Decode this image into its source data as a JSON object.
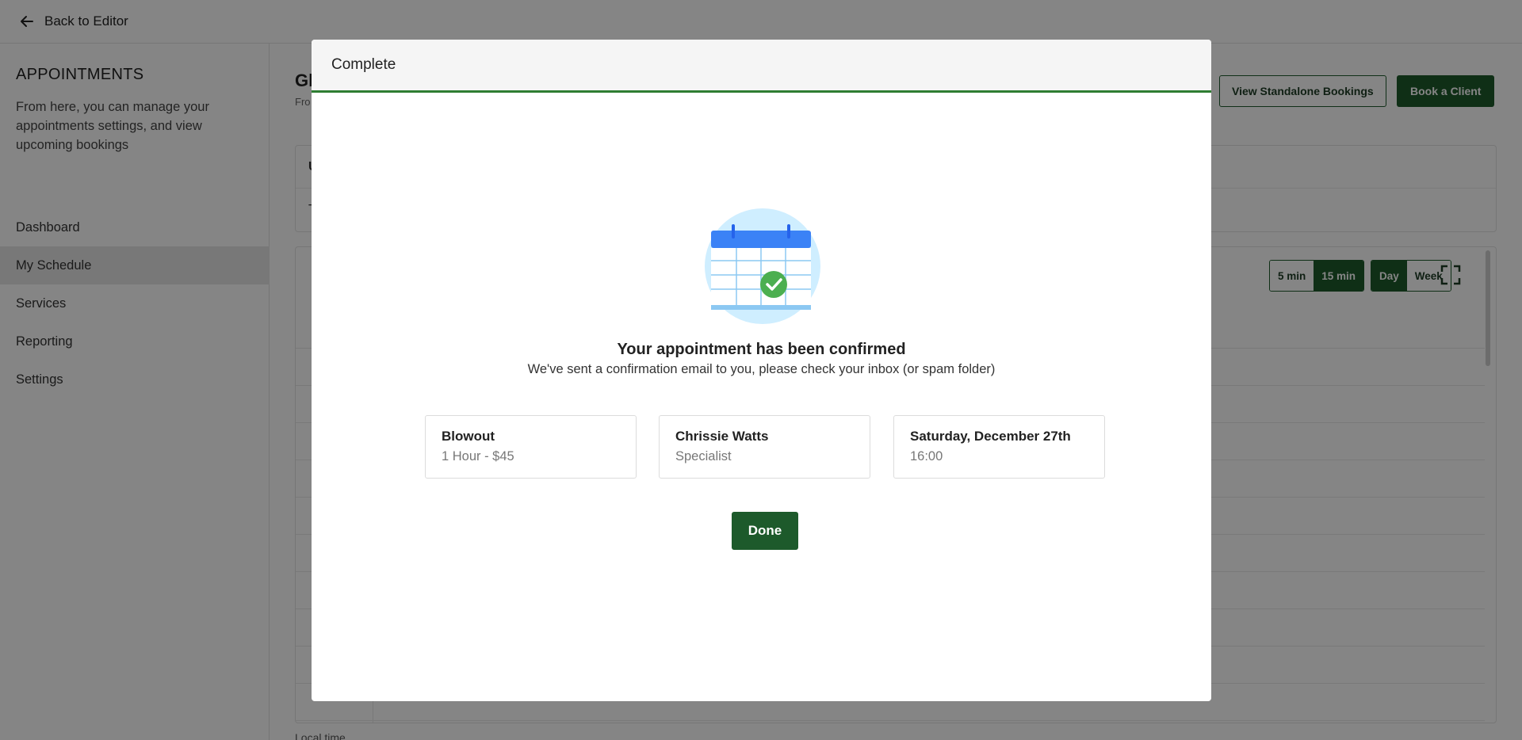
{
  "topbar": {
    "back_label": "Back to Editor"
  },
  "sidebar": {
    "title": "APPOINTMENTS",
    "description": "From here, you can manage your appointments settings, and view upcoming bookings",
    "items": [
      {
        "label": "Dashboard"
      },
      {
        "label": "My Schedule",
        "active": true
      },
      {
        "label": "Services"
      },
      {
        "label": "Reporting"
      },
      {
        "label": "Settings"
      }
    ]
  },
  "main": {
    "title": "Gl",
    "subtitle": "Fro",
    "view_standalone_label": "View Standalone Bookings",
    "book_client_label": "Book a Client",
    "card_row1": "U",
    "card_row2": "T",
    "interval_options": [
      "5 min",
      "15 min"
    ],
    "interval_selected": "15 min",
    "range_options": [
      "Day",
      "Week"
    ],
    "range_selected": "Day",
    "footer_text": "Local time"
  },
  "modal": {
    "header": "Complete",
    "title": "Your appointment has been confirmed",
    "subtitle": "We've sent a confirmation email to you, please check your inbox (or spam folder)",
    "service": {
      "name": "Blowout",
      "detail": "1 Hour - $45"
    },
    "staff": {
      "name": "Chrissie Watts",
      "role": "Specialist"
    },
    "datetime": {
      "date": "Saturday, December 27th",
      "time": "16:00"
    },
    "done_label": "Done"
  },
  "colors": {
    "brand_green": "#1d5a2b",
    "header_accent": "#2e7d32",
    "calendar_blue": "#3b82f6",
    "check_green": "#4caf50",
    "illustration_bg": "#cfeeff"
  }
}
